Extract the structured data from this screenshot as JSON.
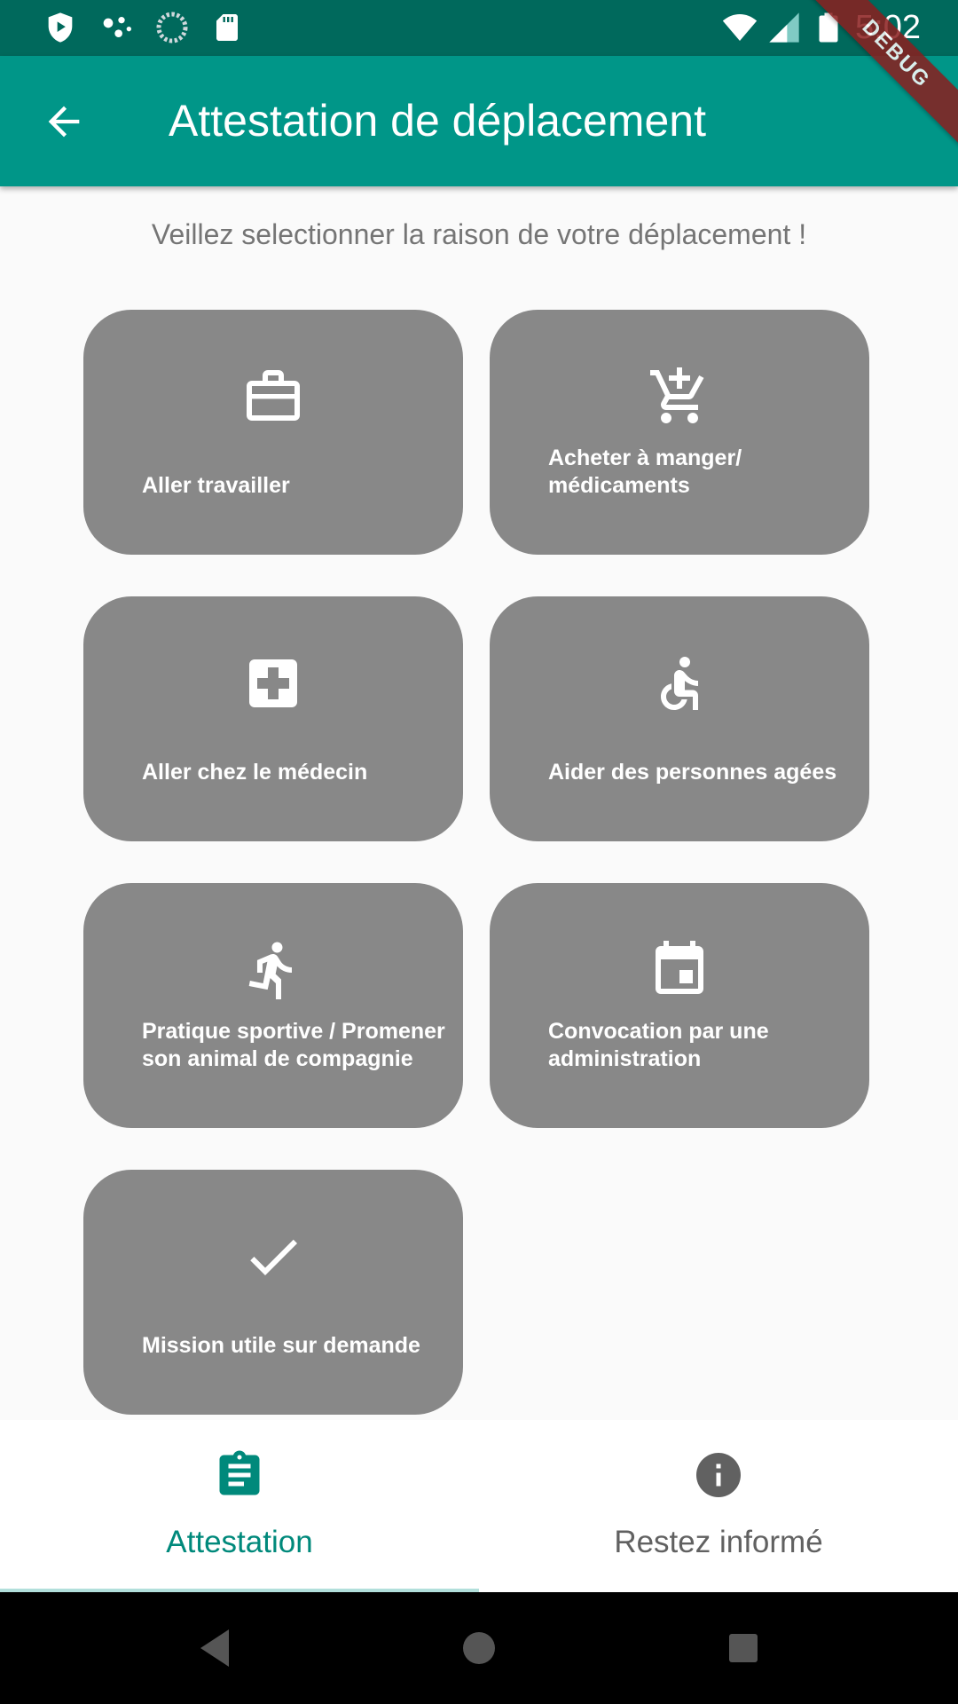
{
  "status_bar": {
    "time": "5:02",
    "left_icons": [
      "play-protect-icon",
      "dots-icon",
      "loading-circle-icon",
      "sd-card-icon"
    ],
    "right_icons": [
      "wifi-icon",
      "signal-icon",
      "battery-icon"
    ]
  },
  "app_bar": {
    "title": "Attestation de déplacement",
    "back_icon": "arrow-back-icon",
    "debug_banner": "DEBUG",
    "color": "#009688"
  },
  "prompt": "Veillez selectionner la raison de votre déplacement !",
  "reasons": [
    {
      "label": "Aller travailler",
      "icon": "briefcase-icon"
    },
    {
      "label": "Acheter à manger/ médicaments",
      "icon": "add-shopping-cart-icon"
    },
    {
      "label": "Aller chez le médecin",
      "icon": "medical-cross-icon"
    },
    {
      "label": "Aider des personnes agées",
      "icon": "accessible-icon"
    },
    {
      "label": "Pratique sportive / Promener son animal de compagnie",
      "icon": "running-icon"
    },
    {
      "label": "Convocation par une administration",
      "icon": "calendar-event-icon"
    },
    {
      "label": "Mission utile sur demande",
      "icon": "check-icon"
    }
  ],
  "bottom_nav": {
    "tabs": [
      {
        "label": "Attestation",
        "icon": "clipboard-icon",
        "selected": true,
        "color": "#00897b"
      },
      {
        "label": "Restez informé",
        "icon": "info-icon",
        "selected": false,
        "color": "#616161"
      }
    ]
  },
  "system_nav": {
    "buttons": [
      "back-triangle-icon",
      "home-circle-icon",
      "recents-square-icon"
    ]
  }
}
